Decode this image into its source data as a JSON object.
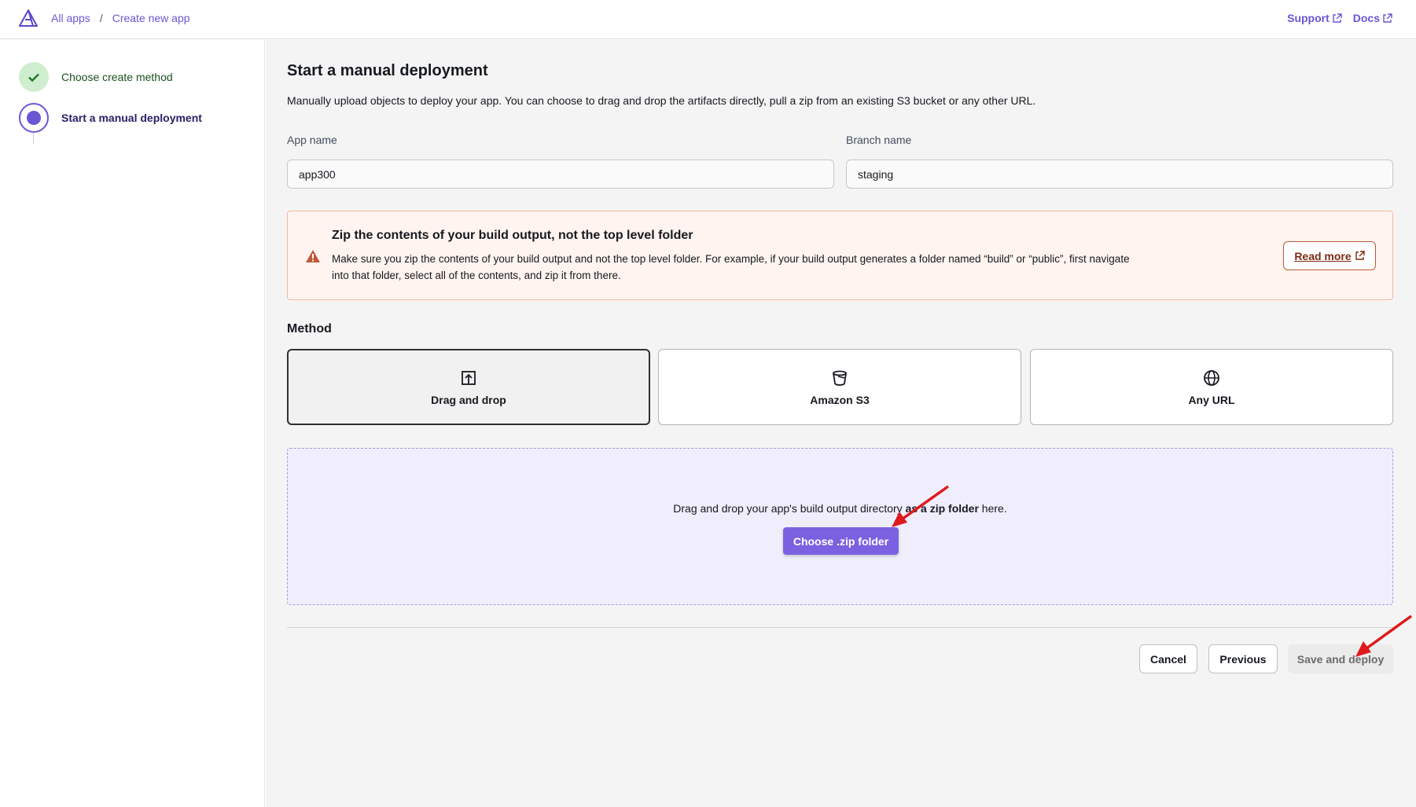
{
  "header": {
    "breadcrumb": [
      "All apps",
      "Create new app"
    ],
    "breadcrumb_sep": "/",
    "links": [
      "Support",
      "Docs"
    ]
  },
  "sidebar": {
    "steps": [
      {
        "label": "Choose create method",
        "status": "complete"
      },
      {
        "label": "Start a manual deployment",
        "status": "current"
      }
    ]
  },
  "main": {
    "title": "Start a manual deployment",
    "description": "Manually upload objects to deploy your app. You can choose to drag and drop the artifacts directly, pull a zip from an existing S3 bucket or any other URL.",
    "app_name_label": "App name",
    "app_name_value": "app300",
    "branch_name_label": "Branch name",
    "branch_name_value": "staging",
    "alert": {
      "title": "Zip the contents of your build output, not the top level folder",
      "body": "Make sure you zip the contents of your build output and not the top level folder. For example, if your build output generates a folder named “build” or “public”, first navigate into that folder, select all of the contents, and zip it from there.",
      "button": "Read more"
    },
    "method_label": "Method",
    "methods": [
      {
        "label": "Drag and drop",
        "icon": "upload-icon",
        "selected": true
      },
      {
        "label": "Amazon S3",
        "icon": "bucket-icon",
        "selected": false
      },
      {
        "label": "Any URL",
        "icon": "globe-icon",
        "selected": false
      }
    ],
    "dropzone": {
      "text_before": "Drag and drop your app's build output directory ",
      "text_bold": "as a zip folder",
      "text_after": " here.",
      "button": "Choose .zip folder"
    },
    "footer": {
      "cancel": "Cancel",
      "previous": "Previous",
      "save": "Save and deploy"
    }
  },
  "colors": {
    "accent": "#7b61e0",
    "warning": "#c0583a",
    "annotation_arrow": "#e0191c"
  }
}
